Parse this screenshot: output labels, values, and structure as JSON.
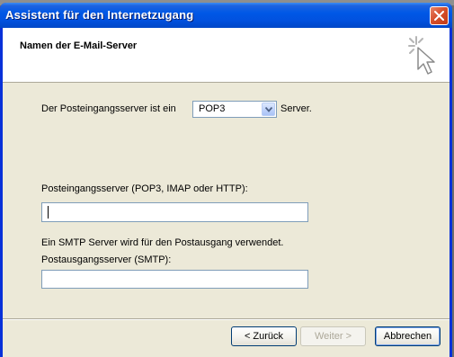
{
  "window": {
    "title": "Assistent für den Internetzugang"
  },
  "header": {
    "title": "Namen der E-Mail-Server"
  },
  "form": {
    "incoming_type_prefix": "Der Posteingangsserver ist ein",
    "incoming_type_value": "POP3",
    "incoming_type_suffix": "Server.",
    "incoming_server_label": "Posteingangsserver (POP3, IMAP oder HTTP):",
    "incoming_server_value": "",
    "smtp_note": "Ein SMTP Server wird für den Postausgang verwendet.",
    "outgoing_server_label": "Postausgangsserver (SMTP):",
    "outgoing_server_value": ""
  },
  "buttons": {
    "back": "< Zurück",
    "next": "Weiter >",
    "cancel": "Abbrechen"
  },
  "icons": {
    "close": "close-icon",
    "wizard": "wizard-sparkle-cursor-icon",
    "dropdown": "chevron-down-icon"
  },
  "colors": {
    "titlebar": "#0058e6",
    "dialog_bg": "#ece9d8",
    "close_button": "#d7502c"
  }
}
